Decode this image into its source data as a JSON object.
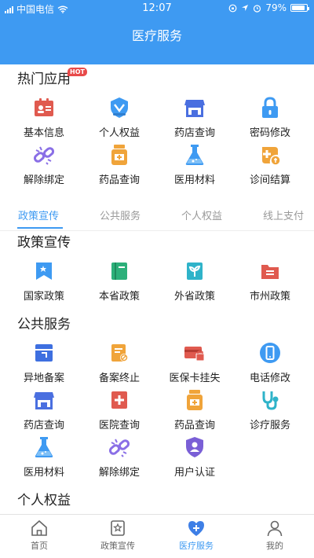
{
  "status": {
    "carrier": "中国电信",
    "time": "12:07",
    "battery": "79%"
  },
  "header": {
    "title": "医疗服务"
  },
  "hot_apps": {
    "title": "热门应用",
    "badge": "HOT",
    "items": [
      {
        "label": "基本信息",
        "icon": "id-card-icon",
        "color": "#e05a4f"
      },
      {
        "label": "个人权益",
        "icon": "badge-icon",
        "color": "#3e9af2"
      },
      {
        "label": "药店查询",
        "icon": "store-icon",
        "color": "#4a6fe0"
      },
      {
        "label": "密码修改",
        "icon": "lock-icon",
        "color": "#3e9af2"
      },
      {
        "label": "解除绑定",
        "icon": "unlink-icon",
        "color": "#8a6fe6"
      },
      {
        "label": "药品查询",
        "icon": "medicine-bottle-icon",
        "color": "#f0a43a"
      },
      {
        "label": "医用材料",
        "icon": "flask-icon",
        "color": "#3e9af2"
      },
      {
        "label": "诊间结算",
        "icon": "coin-plus-icon",
        "color": "#f0a43a"
      }
    ]
  },
  "tabs": {
    "items": [
      {
        "label": "政策宣传"
      },
      {
        "label": "公共服务"
      },
      {
        "label": "个人权益"
      },
      {
        "label": "线上支付"
      }
    ]
  },
  "policy": {
    "title": "政策宣传",
    "items": [
      {
        "label": "国家政策",
        "icon": "flag-icon",
        "color": "#3e9af2"
      },
      {
        "label": "本省政策",
        "icon": "book-icon",
        "color": "#2cb07a"
      },
      {
        "label": "外省政策",
        "icon": "plant-icon",
        "color": "#2fb3c9"
      },
      {
        "label": "市州政策",
        "icon": "folder-icon",
        "color": "#e05a4f"
      }
    ]
  },
  "public": {
    "title": "公共服务",
    "items": [
      {
        "label": "异地备案",
        "icon": "box-icon",
        "color": "#3e6fe0"
      },
      {
        "label": "备案终止",
        "icon": "doc-stop-icon",
        "color": "#f0a43a"
      },
      {
        "label": "医保卡挂失",
        "icon": "card-lock-icon",
        "color": "#e05a4f"
      },
      {
        "label": "电话修改",
        "icon": "phone-icon",
        "color": "#3e9af2"
      },
      {
        "label": "药店查询",
        "icon": "store-icon",
        "color": "#4a6fe0"
      },
      {
        "label": "医院查询",
        "icon": "hospital-icon",
        "color": "#e05a4f"
      },
      {
        "label": "药品查询",
        "icon": "medicine-bottle-icon",
        "color": "#f0a43a"
      },
      {
        "label": "诊疗服务",
        "icon": "stethoscope-icon",
        "color": "#2fb3c9"
      },
      {
        "label": "医用材料",
        "icon": "flask-icon",
        "color": "#3e9af2"
      },
      {
        "label": "解除绑定",
        "icon": "unlink-icon",
        "color": "#8a6fe6"
      },
      {
        "label": "用户认证",
        "icon": "user-shield-icon",
        "color": "#7a5fd6"
      }
    ]
  },
  "rights": {
    "title": "个人权益"
  },
  "tabbar": {
    "items": [
      {
        "label": "首页",
        "icon": "home-icon"
      },
      {
        "label": "政策宣传",
        "icon": "star-doc-icon"
      },
      {
        "label": "医疗服务",
        "icon": "heart-plus-icon"
      },
      {
        "label": "我的",
        "icon": "person-icon"
      }
    ]
  }
}
